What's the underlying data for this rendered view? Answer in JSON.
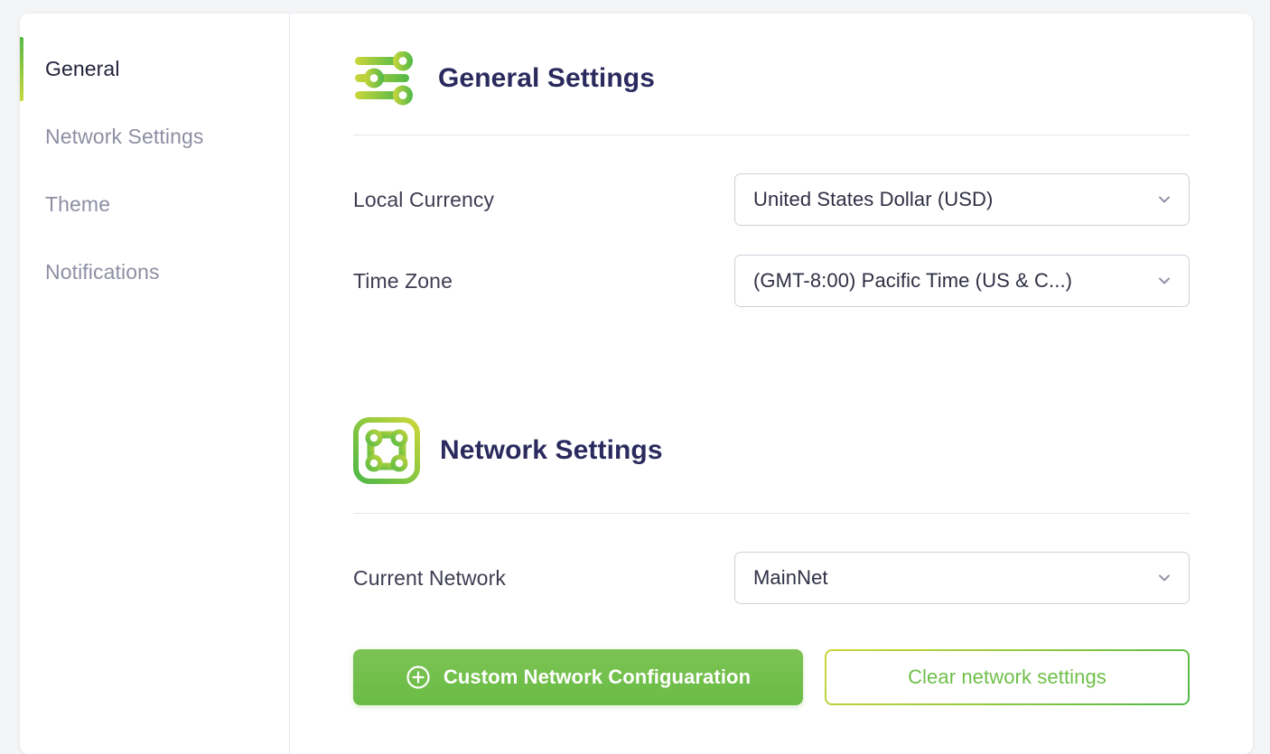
{
  "window": {
    "background_color": "#f4f5f7",
    "card_background": "#ffffff"
  },
  "sidebar": {
    "items": [
      {
        "label": "General",
        "active": true,
        "name": "sidebar-item-general"
      },
      {
        "label": "Network Settings",
        "active": false,
        "name": "sidebar-item-network-settings"
      },
      {
        "label": "Theme",
        "active": false,
        "name": "sidebar-item-theme"
      },
      {
        "label": "Notifications",
        "active": false,
        "name": "sidebar-item-notifications"
      }
    ],
    "active_indicator_color": "#8fc93f"
  },
  "sections": {
    "general": {
      "title": "General Settings",
      "icon": "sliders-icon",
      "rows": {
        "currency": {
          "label": "Local Currency",
          "value": "United States Dollar (USD)",
          "chevron": "chevron-down-icon"
        },
        "timezone": {
          "label": "Time Zone",
          "value": "(GMT-8:00) Pacific Time (US & C...)",
          "chevron": "chevron-down-icon"
        }
      }
    },
    "network": {
      "title": "Network Settings",
      "icon": "network-nodes-icon",
      "rows": {
        "current_network": {
          "label": "Current Network",
          "value": "MainNet",
          "chevron": "chevron-down-icon"
        }
      },
      "buttons": {
        "custom_config": {
          "label": "Custom Network Configuaration",
          "icon": "plus-circle-icon",
          "color": "#6abc45"
        },
        "clear_settings": {
          "label": "Clear network settings",
          "color": "#6fbf4a"
        }
      }
    }
  },
  "colors": {
    "accent_green": "#6abc45",
    "accent_lime": "#c7d63a",
    "title_navy": "#2a2a5e",
    "label_slate": "#3d3d52",
    "muted_grey": "#8e8fa3",
    "border_grey": "#cfd0da"
  }
}
